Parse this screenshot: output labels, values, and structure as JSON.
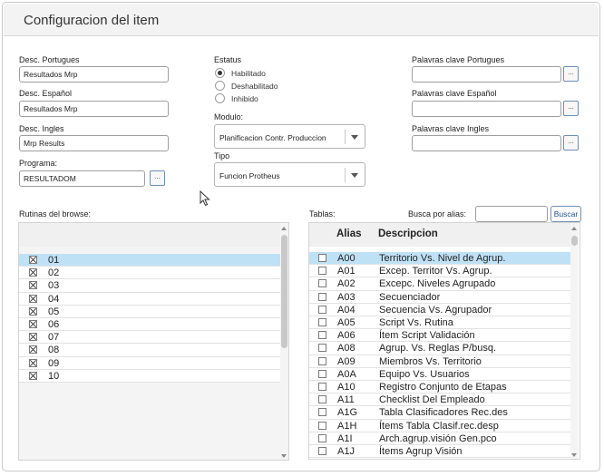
{
  "window": {
    "title": "Configuracion del item"
  },
  "form": {
    "desc_portugues": {
      "label": "Desc. Portugues",
      "value": "Resultados Mrp"
    },
    "desc_espanol": {
      "label": "Desc. Español",
      "value": "Resultados Mrp"
    },
    "desc_ingles": {
      "label": "Desc. Ingles",
      "value": "Mrp Results"
    },
    "programa": {
      "label": "Programa:",
      "value": "RESULTADOM",
      "button": "..."
    },
    "estatus": {
      "label": "Estatus",
      "options": [
        {
          "label": "Habilitado",
          "checked": true
        },
        {
          "label": "Deshabilitado",
          "checked": false
        },
        {
          "label": "Inhibido",
          "checked": false
        }
      ]
    },
    "modulo": {
      "label": "Modulo:",
      "value": "Planificacion Contr. Produccion"
    },
    "tipo": {
      "label": "Tipo",
      "value": "Funcion Protheus"
    },
    "palavras_portugues": {
      "label": "Palavras clave Portugues",
      "value": "",
      "button": "..."
    },
    "palavras_espanol": {
      "label": "Palavras clave Español",
      "value": "",
      "button": "..."
    },
    "palavras_ingles": {
      "label": "Palavras clave Ingles",
      "value": "",
      "button": "..."
    }
  },
  "rutinas": {
    "label": "Rutinas del browse:",
    "rows": [
      {
        "checked": true,
        "value": "01",
        "selected": true
      },
      {
        "checked": true,
        "value": "02",
        "selected": false
      },
      {
        "checked": true,
        "value": "03",
        "selected": false
      },
      {
        "checked": true,
        "value": "04",
        "selected": false
      },
      {
        "checked": true,
        "value": "05",
        "selected": false
      },
      {
        "checked": true,
        "value": "06",
        "selected": false
      },
      {
        "checked": true,
        "value": "07",
        "selected": false
      },
      {
        "checked": true,
        "value": "08",
        "selected": false
      },
      {
        "checked": true,
        "value": "09",
        "selected": false
      },
      {
        "checked": true,
        "value": "10",
        "selected": false
      }
    ]
  },
  "tablas": {
    "label": "Tablas:",
    "search_label": "Busca por alias:",
    "search_value": "",
    "search_button": "Buscar",
    "columns": [
      "Alias",
      "Descripcion"
    ],
    "rows": [
      {
        "checked": false,
        "alias": "A00",
        "desc": "Territorio Vs. Nivel de Agrup.",
        "selected": true
      },
      {
        "checked": false,
        "alias": "A01",
        "desc": "Excep. Territor Vs. Agrup.",
        "selected": false
      },
      {
        "checked": false,
        "alias": "A02",
        "desc": "Excepc. Niveles Agrupado",
        "selected": false
      },
      {
        "checked": false,
        "alias": "A03",
        "desc": "Secuenciador",
        "selected": false
      },
      {
        "checked": false,
        "alias": "A04",
        "desc": "Secuencia Vs. Agrupador",
        "selected": false
      },
      {
        "checked": false,
        "alias": "A05",
        "desc": "Script Vs. Rutina",
        "selected": false
      },
      {
        "checked": false,
        "alias": "A06",
        "desc": "Ítem Script Validación",
        "selected": false
      },
      {
        "checked": false,
        "alias": "A08",
        "desc": "Agrup. Vs. Reglas P/busq.",
        "selected": false
      },
      {
        "checked": false,
        "alias": "A09",
        "desc": "Miembros Vs. Territorio",
        "selected": false
      },
      {
        "checked": false,
        "alias": "A0A",
        "desc": "Equipo Vs. Usuarios",
        "selected": false
      },
      {
        "checked": false,
        "alias": "A10",
        "desc": "Registro Conjunto de Etapas",
        "selected": false
      },
      {
        "checked": false,
        "alias": "A11",
        "desc": "Checklist Del Empleado",
        "selected": false
      },
      {
        "checked": false,
        "alias": "A1G",
        "desc": "Tabla Clasificadores Rec.des",
        "selected": false
      },
      {
        "checked": false,
        "alias": "A1H",
        "desc": "Ítems Tabla Clasif.rec.desp",
        "selected": false
      },
      {
        "checked": false,
        "alias": "A1I",
        "desc": "Arch.agrup.visión Gen.pco",
        "selected": false
      },
      {
        "checked": false,
        "alias": "A1J",
        "desc": "Ítems Agrup Visión",
        "selected": false
      }
    ]
  },
  "colors": {
    "selected_row": "#bfe1f5",
    "button_border": "#6f8fb0"
  }
}
